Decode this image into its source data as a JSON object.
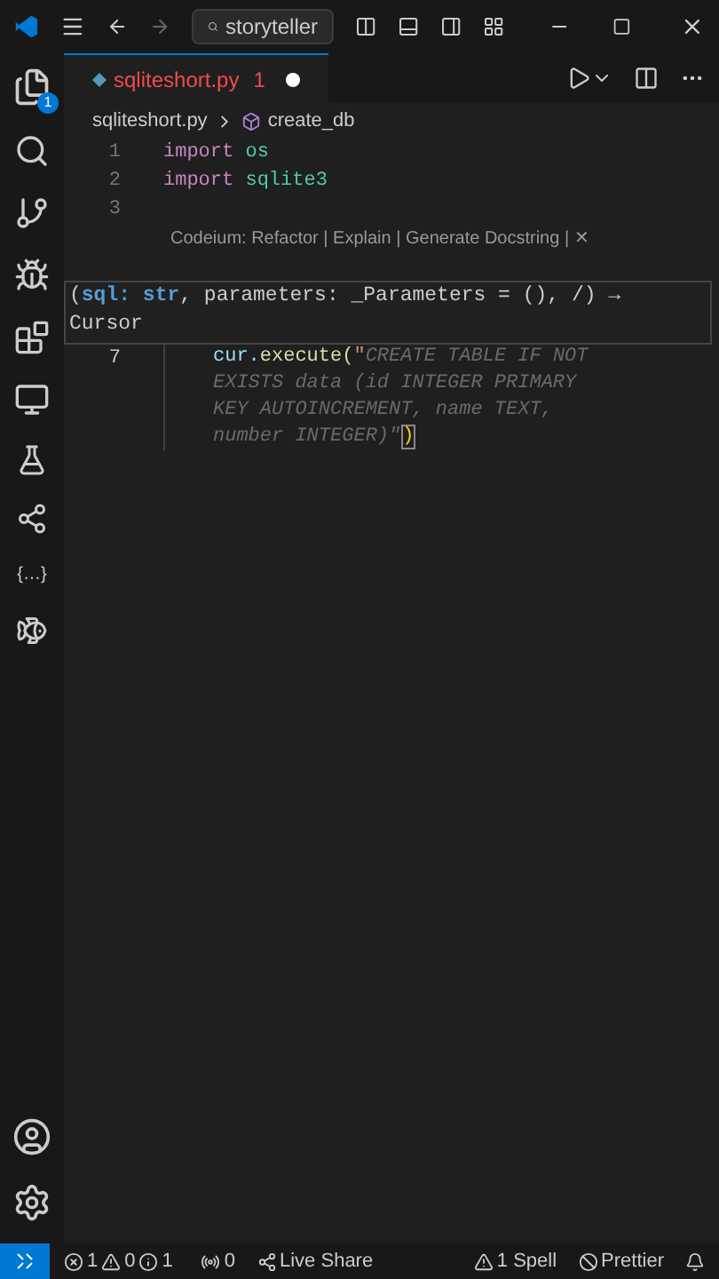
{
  "title_bar": {
    "search": "storyteller"
  },
  "activity_bar": {
    "explorer_badge": "1",
    "json_icon": "{…}"
  },
  "tab": {
    "label": "sqliteshort.py",
    "problems": "1",
    "modified": true
  },
  "breadcrumb": {
    "file": "sqliteshort.py",
    "symbol": "create_db"
  },
  "code_lines": [
    {
      "number": "1",
      "keyword": "import",
      "name": "os"
    },
    {
      "number": "2",
      "keyword": "import",
      "name": "sqlite3"
    },
    {
      "number": "3"
    }
  ],
  "code_lens": "Codeium: Refactor | Explain | Generate Docstring | ✕",
  "hover": {
    "open": "(",
    "param1": "sql: str",
    "rest": ", parameters: _Parameters = (), /) →",
    "returns": "Cursor"
  },
  "current_line": {
    "number": "7",
    "code": "cur.execute(",
    "quote": "\"",
    "suggestion": "CREATE TABLE IF NOT EXISTS data (id INTEGER PRIMARY KEY AUTOINCREMENT, name TEXT, number INTEGER)\"",
    "close": ")"
  },
  "status_bar": {
    "errors": "1",
    "warnings": "0",
    "infos": "1",
    "ports": "0",
    "live_share": "Live Share",
    "spell": "1 Spell",
    "prettier": "Prettier"
  }
}
